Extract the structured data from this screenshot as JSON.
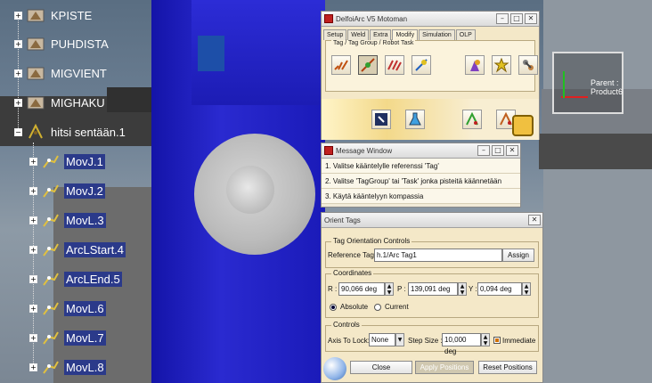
{
  "viewport": {
    "compass_label": "Parent : Product6"
  },
  "tree": {
    "nodes": [
      {
        "label": "KPISTE",
        "icon": "part-icon"
      },
      {
        "label": "PUHDISTA",
        "icon": "part-icon"
      },
      {
        "label": "MIGVIENT",
        "icon": "part-icon"
      },
      {
        "label": "MIGHAKU",
        "icon": "part-icon"
      },
      {
        "label": "hitsi sentään.1",
        "icon": "tag-group-icon"
      },
      {
        "label": "MovJ.1",
        "icon": "robot-move-icon"
      },
      {
        "label": "MovJ.2",
        "icon": "robot-move-icon"
      },
      {
        "label": "MovL.3",
        "icon": "robot-move-icon"
      },
      {
        "label": "ArcLStart.4",
        "icon": "robot-move-icon"
      },
      {
        "label": "ArcLEnd.5",
        "icon": "robot-move-icon"
      },
      {
        "label": "MovL.6",
        "icon": "robot-move-icon"
      },
      {
        "label": "MovL.7",
        "icon": "robot-move-icon"
      },
      {
        "label": "MovL.8",
        "icon": "robot-move-icon"
      }
    ]
  },
  "delfoi": {
    "title": "DelfoiArc V5 Motoman",
    "tabs": [
      "Setup",
      "Weld",
      "Extra",
      "Modify",
      "Simulation",
      "OLP"
    ],
    "active_tab": "Modify",
    "group_title": "Tag / Tag Group / Robot Task"
  },
  "message": {
    "title": "Message Window",
    "lines": [
      "1. Valitse kääntelylle referenssi 'Tag'",
      "2. Valitse 'TagGroup' tai 'Task' jonka pisteitä käännetään",
      "3. Käytä kääntelyyn kompassia"
    ]
  },
  "orient": {
    "title": "Orient Tags",
    "controls_title": "Tag Orientation Controls",
    "reference_label": "Reference Tag",
    "reference_value": "h.1/Arc Tag1",
    "assign_label": "Assign",
    "coords_title": "Coordinates",
    "r_label": "R :",
    "r_value": "90,066 deg",
    "p_label": "P :",
    "p_value": "139,091 deg",
    "y_label": "Y :",
    "y_value": "0,094 deg",
    "absolute_label": "Absolute",
    "current_label": "Current",
    "controls2_title": "Controls",
    "axis_lock_label": "Axis To Lock:",
    "axis_lock_value": "None",
    "step_label": "Step Size :",
    "step_value": "10,000 deg",
    "immediate_label": "Immediate",
    "close_label": "Close",
    "apply_label": "Apply Positions",
    "reset_label": "Reset Positions"
  }
}
